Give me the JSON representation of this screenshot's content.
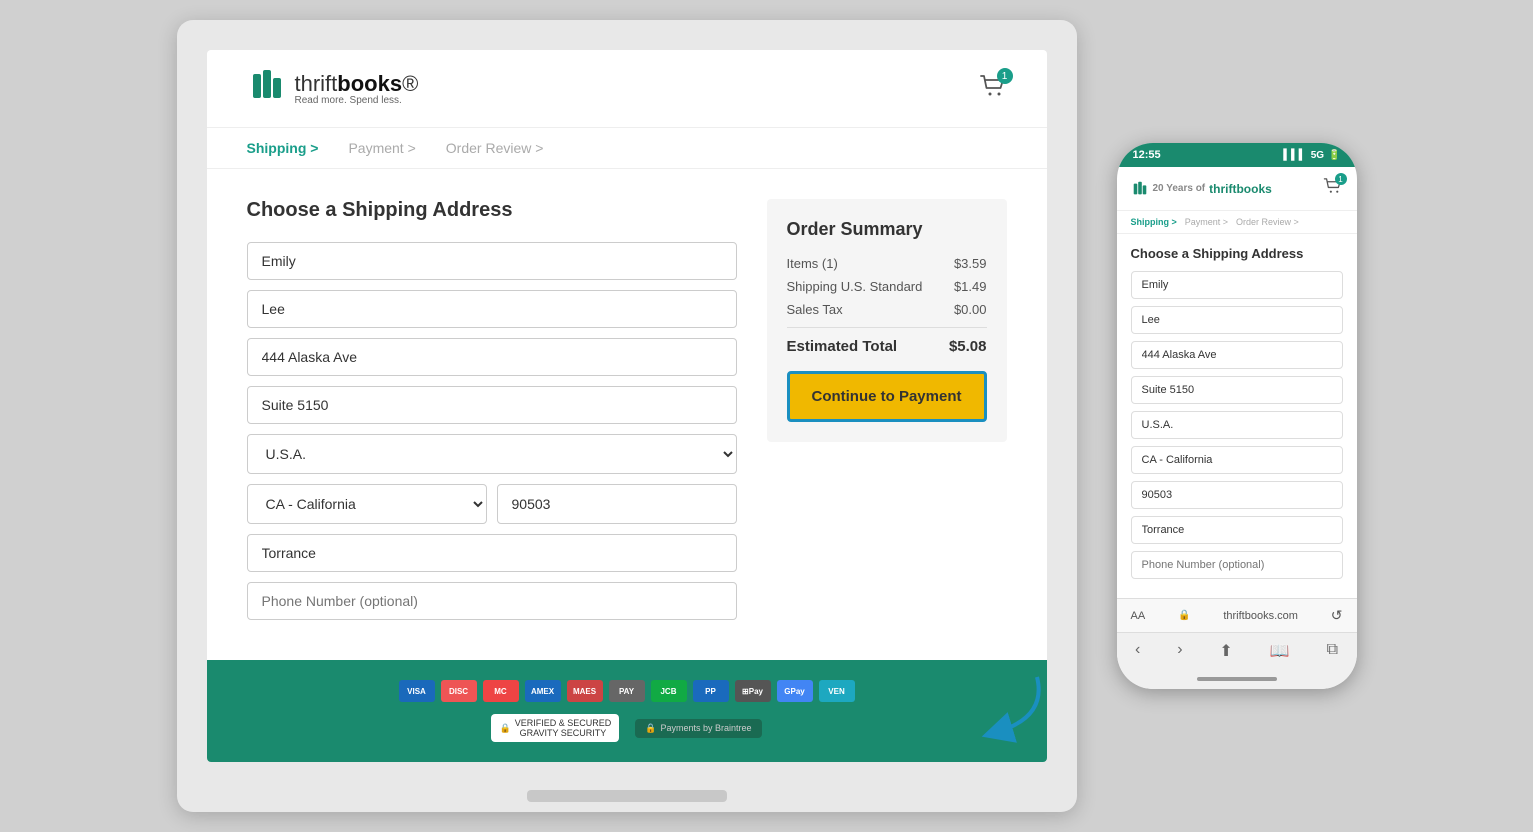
{
  "laptop": {
    "header": {
      "logo_text_light": "thrift",
      "logo_text_bold": "books",
      "logo_trademark": "®",
      "tagline": "Read more. Spend less.",
      "cart_count": "1"
    },
    "breadcrumb": {
      "step1": "Shipping >",
      "step2": "Payment >",
      "step3": "Order Review >"
    },
    "form": {
      "title": "Choose a Shipping Address",
      "first_name_value": "Emily",
      "last_name_value": "Lee",
      "address_value": "444 Alaska Ave",
      "suite_value": "Suite 5150",
      "country_value": "U.S.A.",
      "state_value": "CA - California",
      "zip_value": "90503",
      "city_value": "Torrance",
      "phone_placeholder": "Phone Number (optional)"
    },
    "order_summary": {
      "title": "Order Summary",
      "items_label": "Items (1)",
      "items_value": "$3.59",
      "shipping_label": "Shipping U.S. Standard",
      "shipping_value": "$1.49",
      "tax_label": "Sales Tax",
      "tax_value": "$0.00",
      "total_label": "Estimated Total",
      "total_value": "$5.08",
      "cta_label": "Continue to Payment"
    }
  },
  "phone": {
    "status": {
      "time": "12:55",
      "signal": "5G",
      "battery": "▮"
    },
    "header": {
      "logo": "thriftbooks",
      "cart_badge": "1"
    },
    "breadcrumb": {
      "step1": "Shipping >",
      "step2": "Payment >",
      "step3": "Order Review >"
    },
    "form": {
      "title": "Choose a Shipping Address",
      "first_name_value": "Emily",
      "last_name_value": "Lee",
      "address_value": "444 Alaska Ave",
      "suite_value": "Suite 5150",
      "country_value": "U.S.A.",
      "state_value": "CA - California",
      "zip_value": "90503",
      "city_value": "Torrance",
      "phone_placeholder": "Phone Number (optional)"
    },
    "footer": {
      "url": "thriftbooks.com"
    }
  },
  "payment_icons": [
    "VISA",
    "DISC",
    "MC",
    "AMEX",
    "MAES",
    "PAY",
    "JCB",
    "PP",
    "APay",
    "GPay",
    "VEN"
  ],
  "colors": {
    "brand_green": "#1a8a6e",
    "brand_teal": "#1a9e8a",
    "cta_yellow": "#f0b800",
    "border_blue": "#1a8fc0"
  }
}
